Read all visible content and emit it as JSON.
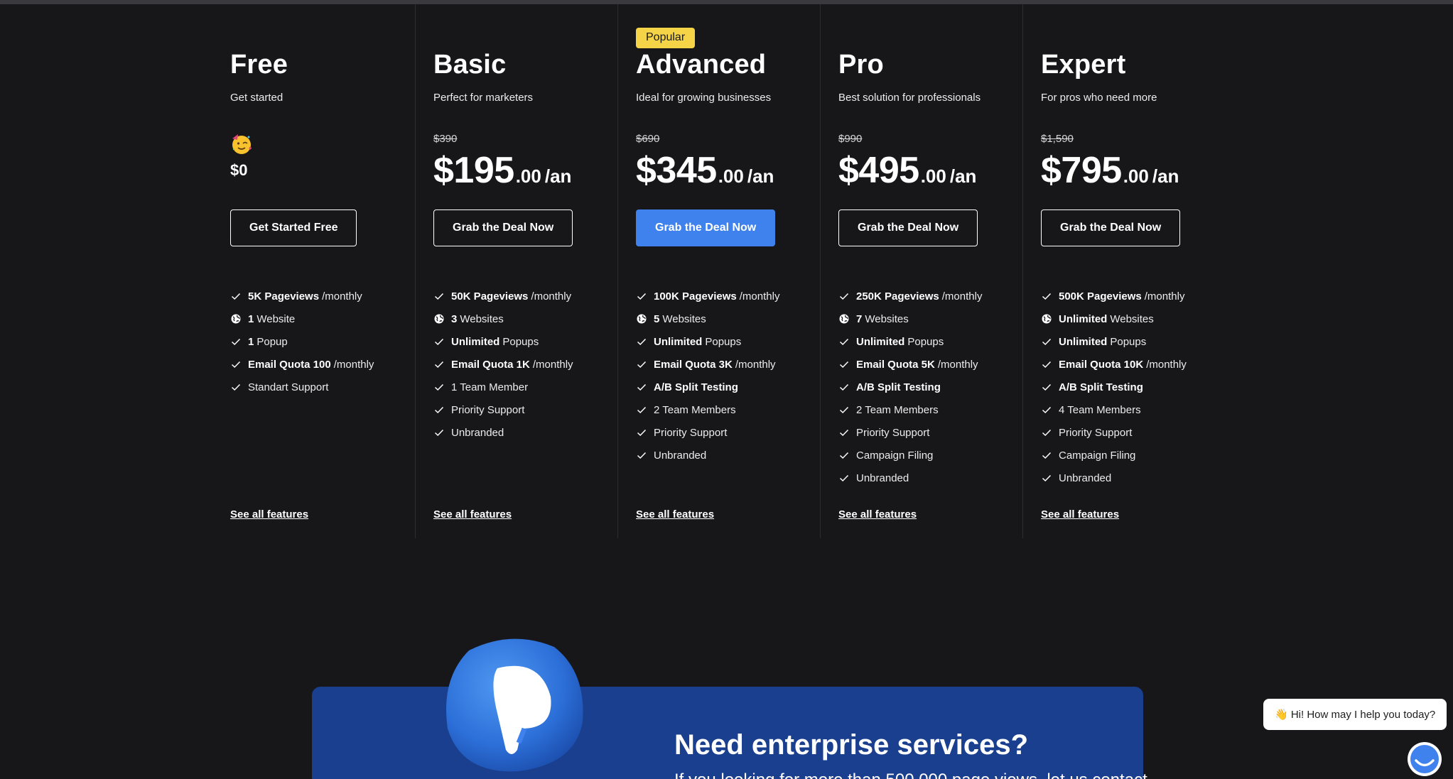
{
  "plans": [
    {
      "name": "Free",
      "tagline": "Get started",
      "badge": "",
      "old_price": "",
      "price": "$0",
      "cents": "",
      "period": "",
      "cta": "Get Started Free",
      "features": [
        {
          "icon": "check-icon",
          "bold": "5K Pageviews",
          "rest": "/monthly"
        },
        {
          "icon": "globe-icon",
          "bold": "1",
          "rest": "Website"
        },
        {
          "icon": "check-icon",
          "bold": "1",
          "rest": "Popup"
        },
        {
          "icon": "check-icon",
          "bold": "Email Quota 100",
          "rest": " /monthly"
        },
        {
          "icon": "check-icon",
          "bold": "",
          "rest": "Standart Support"
        }
      ],
      "see_all": "See all features"
    },
    {
      "name": "Basic",
      "tagline": "Perfect for marketers",
      "badge": "",
      "old_price": "$390",
      "price": "$195",
      "cents": ".00",
      "period": "/an",
      "cta": "Grab the Deal Now",
      "features": [
        {
          "icon": "check-icon",
          "bold": "50K Pageviews",
          "rest": "/monthly"
        },
        {
          "icon": "globe-icon",
          "bold": "3",
          "rest": "Websites"
        },
        {
          "icon": "check-icon",
          "bold": "Unlimited",
          "rest": "Popups"
        },
        {
          "icon": "check-icon",
          "bold": "Email Quota 1K",
          "rest": "/monthly"
        },
        {
          "icon": "check-icon",
          "bold": "",
          "rest": "1 Team Member"
        },
        {
          "icon": "check-icon",
          "bold": "",
          "rest": "Priority Support"
        },
        {
          "icon": "check-icon",
          "bold": "",
          "rest": "Unbranded"
        }
      ],
      "see_all": "See all features"
    },
    {
      "name": "Advanced",
      "tagline": "Ideal for growing businesses",
      "badge": "Popular",
      "old_price": "$690",
      "price": "$345",
      "cents": ".00",
      "period": "/an",
      "cta": "Grab the Deal Now",
      "features": [
        {
          "icon": "check-icon",
          "bold": "100K Pageviews",
          "rest": "/monthly"
        },
        {
          "icon": "globe-icon",
          "bold": "5",
          "rest": "Websites"
        },
        {
          "icon": "check-icon",
          "bold": "Unlimited",
          "rest": "Popups"
        },
        {
          "icon": "check-icon",
          "bold": "Email Quota 3K",
          "rest": "/monthly"
        },
        {
          "icon": "check-icon",
          "bold": "A/B Split Testing",
          "rest": ""
        },
        {
          "icon": "check-icon",
          "bold": "",
          "rest": "2 Team Members"
        },
        {
          "icon": "check-icon",
          "bold": "",
          "rest": "Priority Support"
        },
        {
          "icon": "check-icon",
          "bold": "",
          "rest": "Unbranded"
        }
      ],
      "see_all": "See all features"
    },
    {
      "name": "Pro",
      "tagline": "Best solution for professionals",
      "badge": "",
      "old_price": "$990",
      "price": "$495",
      "cents": ".00",
      "period": "/an",
      "cta": "Grab the Deal Now",
      "features": [
        {
          "icon": "check-icon",
          "bold": "250K Pageviews",
          "rest": "/monthly"
        },
        {
          "icon": "globe-icon",
          "bold": "7",
          "rest": "Websites"
        },
        {
          "icon": "check-icon",
          "bold": "Unlimited",
          "rest": "Popups"
        },
        {
          "icon": "check-icon",
          "bold": "Email Quota 5K",
          "rest": " /monthly"
        },
        {
          "icon": "check-icon",
          "bold": "A/B Split Testing",
          "rest": ""
        },
        {
          "icon": "check-icon",
          "bold": "",
          "rest": "2 Team Members"
        },
        {
          "icon": "check-icon",
          "bold": "",
          "rest": "Priority Support"
        },
        {
          "icon": "check-icon",
          "bold": "",
          "rest": "Campaign Filing"
        },
        {
          "icon": "check-icon",
          "bold": "",
          "rest": "Unbranded"
        }
      ],
      "see_all": "See all features"
    },
    {
      "name": "Expert",
      "tagline": "For pros who need more",
      "badge": "",
      "old_price": "$1,590",
      "price": "$795",
      "cents": ".00",
      "period": "/an",
      "cta": "Grab the Deal Now",
      "features": [
        {
          "icon": "check-icon",
          "bold": "500K Pageviews",
          "rest": "/monthly"
        },
        {
          "icon": "globe-icon",
          "bold": "Unlimited",
          "rest": "Websites"
        },
        {
          "icon": "check-icon",
          "bold": "Unlimited",
          "rest": "Popups"
        },
        {
          "icon": "check-icon",
          "bold": "Email Quota 10K",
          "rest": "/monthly"
        },
        {
          "icon": "check-icon",
          "bold": "A/B Split Testing",
          "rest": ""
        },
        {
          "icon": "check-icon",
          "bold": "",
          "rest": "4 Team Members"
        },
        {
          "icon": "check-icon",
          "bold": "",
          "rest": "Priority Support"
        },
        {
          "icon": "check-icon",
          "bold": "",
          "rest": "Campaign Filing"
        },
        {
          "icon": "check-icon",
          "bold": "",
          "rest": "Unbranded"
        }
      ],
      "see_all": "See all features"
    }
  ],
  "enterprise": {
    "title": "Need enterprise services?",
    "subtitle": "If you looking for more than 500.000 page views, let us contact"
  },
  "chat": {
    "greeting": "👋 Hi! How may I help you today?"
  },
  "colors": {
    "background": "#17171a",
    "accent": "#3f82ee",
    "badge": "#f5d547",
    "enterprise_panel": "#1b3f8f"
  }
}
